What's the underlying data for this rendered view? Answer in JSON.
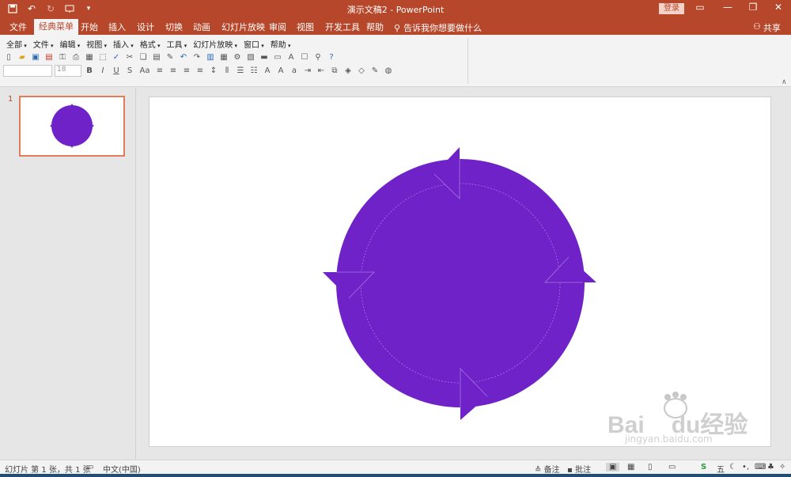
{
  "window": {
    "title": "演示文稿2 - PowerPoint",
    "login_label": "登录"
  },
  "ribbon_tabs": [
    "文件",
    "经典菜单",
    "开始",
    "插入",
    "设计",
    "切换",
    "动画",
    "幻灯片放映",
    "审阅",
    "视图",
    "开发工具",
    "帮助"
  ],
  "active_tab": "经典菜单",
  "tell_me": "告诉我你想要做什么",
  "share_label": "共享",
  "classic_menu": [
    "全部",
    "文件",
    "编辑",
    "视图",
    "插入",
    "格式",
    "工具",
    "幻灯片放映",
    "窗口",
    "帮助"
  ],
  "font_size_value": "18",
  "format_buttons": [
    "B",
    "I",
    "U",
    "S",
    "Aa"
  ],
  "slide_panel": {
    "slide_number": "1"
  },
  "slide": {
    "circle_color": "#6e22c8",
    "background": "#ffffff"
  },
  "status": {
    "slide_info": "幻灯片 第 1 张，共 1 张",
    "language": "中文(中国)",
    "notes": "备注",
    "comments": "批注"
  },
  "colors": {
    "brand": "#b7472a",
    "accent_purple": "#6e22c8"
  },
  "watermark": {
    "brand": "Bai",
    "brand2": "du",
    "cn": "经验",
    "url": "jingyan.baidu.com"
  }
}
